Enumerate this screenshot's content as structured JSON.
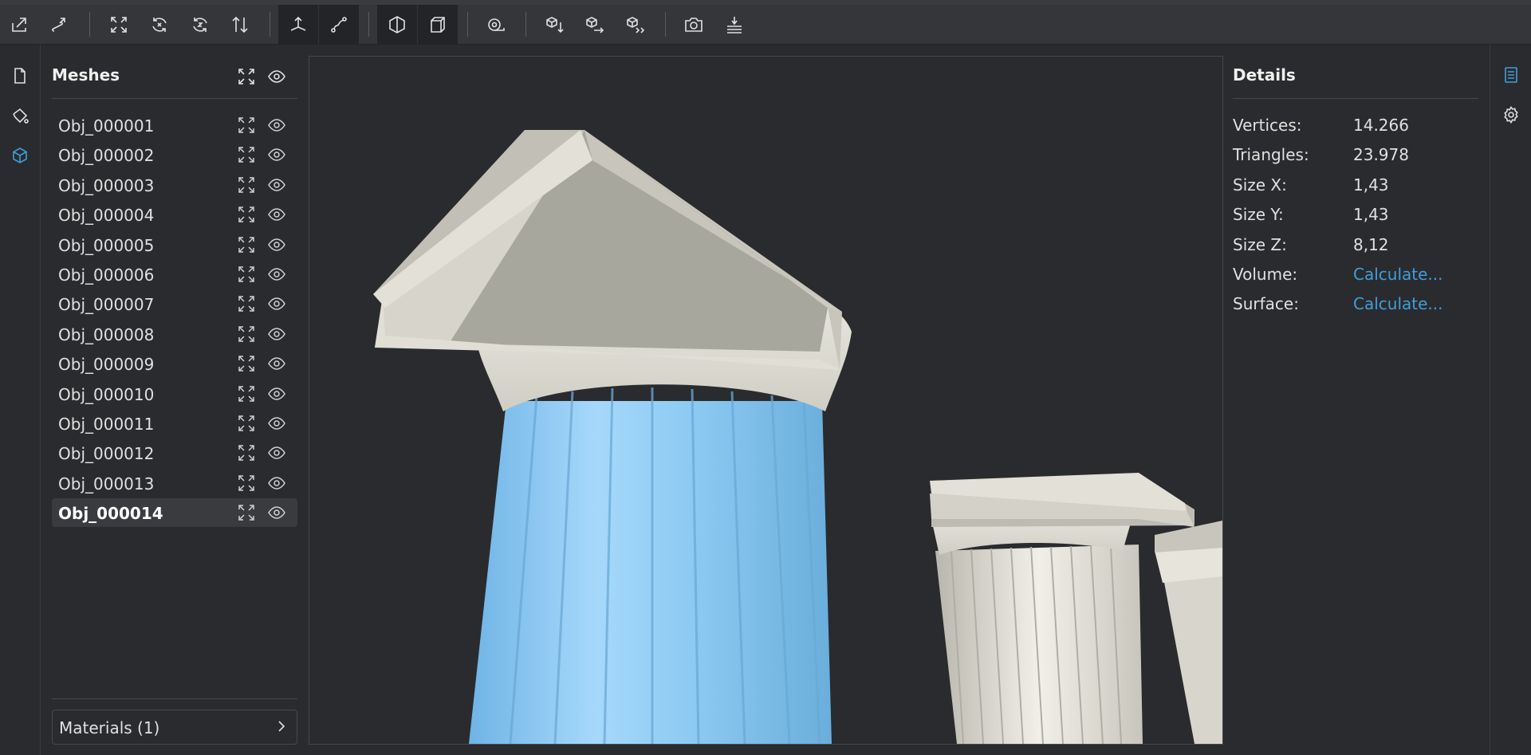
{
  "toolbar": {
    "buttons": [
      {
        "name": "import-icon",
        "x": 0
      },
      {
        "name": "export-icon",
        "x": 0
      },
      {
        "name": "fit-view-icon",
        "x": 0
      },
      {
        "name": "rotate-x-icon",
        "x": 0
      },
      {
        "name": "rotate-z-icon",
        "x": 0
      },
      {
        "name": "flip-icon",
        "x": 0
      },
      {
        "name": "place-on-ground-icon",
        "x": 0
      },
      {
        "name": "measure-path-icon",
        "x": 0
      },
      {
        "name": "cross-section-icon",
        "x": 0
      },
      {
        "name": "box-view-icon",
        "x": 0
      },
      {
        "name": "tape-measure-icon",
        "x": 0
      },
      {
        "name": "move-down-icon",
        "x": 0
      },
      {
        "name": "move-right-icon",
        "x": 0
      },
      {
        "name": "move-both-icon",
        "x": 0
      },
      {
        "name": "camera-icon",
        "x": 0
      },
      {
        "name": "base-plate-icon",
        "x": 0
      }
    ]
  },
  "meshes": {
    "title": "Meshes",
    "items": [
      {
        "label": "Obj_000001"
      },
      {
        "label": "Obj_000002"
      },
      {
        "label": "Obj_000003"
      },
      {
        "label": "Obj_000004"
      },
      {
        "label": "Obj_000005"
      },
      {
        "label": "Obj_000006"
      },
      {
        "label": "Obj_000007"
      },
      {
        "label": "Obj_000008"
      },
      {
        "label": "Obj_000009"
      },
      {
        "label": "Obj_000010"
      },
      {
        "label": "Obj_000011"
      },
      {
        "label": "Obj_000012"
      },
      {
        "label": "Obj_000013"
      },
      {
        "label": "Obj_000014",
        "selected": true
      }
    ],
    "materials_label": "Materials (1)"
  },
  "details": {
    "title": "Details",
    "rows": [
      {
        "label": "Vertices:",
        "value": "14.266"
      },
      {
        "label": "Triangles:",
        "value": "23.978"
      },
      {
        "label": "Size X:",
        "value": "1,43"
      },
      {
        "label": "Size Y:",
        "value": "1,43"
      },
      {
        "label": "Size Z:",
        "value": "8,12"
      },
      {
        "label": "Volume:",
        "value": "Calculate...",
        "link": true
      },
      {
        "label": "Surface:",
        "value": "Calculate...",
        "link": true
      }
    ]
  },
  "colors": {
    "accent": "#3f9fd9",
    "selected_mesh": "#8ecbf2",
    "mesh": "#e6e4dc",
    "background": "#2a2b2e"
  }
}
